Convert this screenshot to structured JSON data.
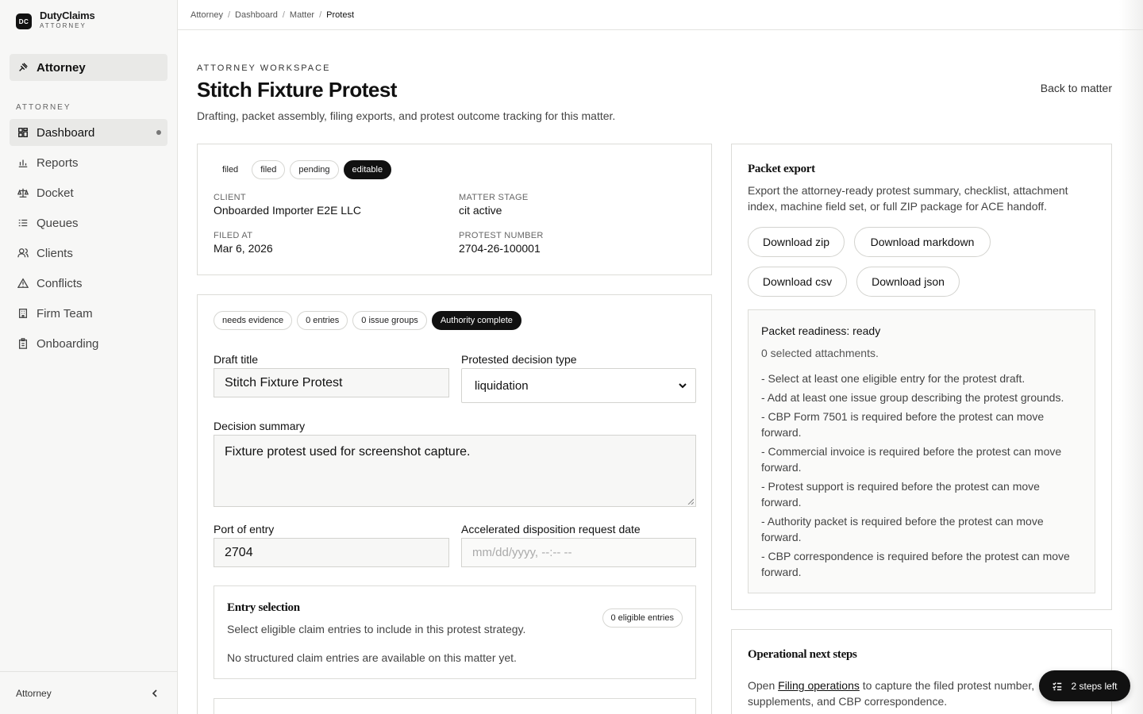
{
  "brand": {
    "logo": "DC",
    "name": "DutyClaims",
    "sub": "ATTORNEY"
  },
  "sidebar": {
    "top_item": {
      "label": "Attorney",
      "icon": "gavel-icon"
    },
    "section_label": "ATTORNEY",
    "items": [
      {
        "label": "Dashboard",
        "icon": "dashboard-icon",
        "active": true
      },
      {
        "label": "Reports",
        "icon": "bar-chart-icon"
      },
      {
        "label": "Docket",
        "icon": "scale-icon"
      },
      {
        "label": "Queues",
        "icon": "list-icon"
      },
      {
        "label": "Clients",
        "icon": "users-icon"
      },
      {
        "label": "Conflicts",
        "icon": "warning-icon"
      },
      {
        "label": "Firm Team",
        "icon": "building-icon"
      },
      {
        "label": "Onboarding",
        "icon": "clipboard-icon"
      }
    ],
    "footer_label": "Attorney"
  },
  "breadcrumb": [
    "Attorney",
    "Dashboard",
    "Matter",
    "Protest"
  ],
  "header": {
    "eyebrow": "ATTORNEY WORKSPACE",
    "title": "Stitch Fixture Protest",
    "description": "Drafting, packet assembly, filing exports, and protest outcome tracking for this matter.",
    "back_link": "Back to matter"
  },
  "summary_card": {
    "pills": [
      "filed",
      "filed",
      "pending",
      "editable"
    ],
    "fields": {
      "client_label": "CLIENT",
      "client_value": "Onboarded Importer E2E LLC",
      "stage_label": "MATTER STAGE",
      "stage_value": "cit active",
      "filed_label": "FILED AT",
      "filed_value": "Mar 6, 2026",
      "protest_label": "PROTEST NUMBER",
      "protest_value": "2704-26-100001"
    }
  },
  "draft_card": {
    "pills": [
      "needs evidence",
      "0 entries",
      "0 issue groups",
      "Authority complete"
    ],
    "draft_title_label": "Draft title",
    "draft_title_value": "Stitch Fixture Protest",
    "decision_type_label": "Protested decision type",
    "decision_type_value": "liquidation",
    "summary_label": "Decision summary",
    "summary_value": "Fixture protest used for screenshot capture.",
    "port_label": "Port of entry",
    "port_value": "2704",
    "accel_label": "Accelerated disposition request date",
    "accel_placeholder": "mm/dd/yyyy, --:-- --"
  },
  "entry_selection": {
    "title": "Entry selection",
    "badge": "0 eligible entries",
    "desc": "Select eligible claim entries to include in this protest strategy.",
    "empty": "No structured claim entries are available on this matter yet."
  },
  "packet_export": {
    "title": "Packet export",
    "desc": "Export the attorney-ready protest summary, checklist, attachment index, machine field set, or full ZIP package for ACE handoff.",
    "buttons": [
      "Download zip",
      "Download markdown",
      "Download csv",
      "Download json"
    ],
    "readiness_title": "Packet readiness: ready",
    "readiness_sub": "0 selected attachments.",
    "requirements": [
      "- Select at least one eligible entry for the protest draft.",
      "- Add at least one issue group describing the protest grounds.",
      "- CBP Form 7501 is required before the protest can move forward.",
      "- Commercial invoice is required before the protest can move forward.",
      "- Protest support is required before the protest can move forward.",
      "- Authority packet is required before the protest can move forward.",
      "- CBP correspondence is required before the protest can move forward."
    ]
  },
  "next_steps": {
    "title": "Operational next steps",
    "text_before": "Open ",
    "link": "Filing operations",
    "text_after": " to capture the filed protest number, supplements, and CBP correspondence."
  },
  "toast": {
    "label": "2 steps left"
  }
}
